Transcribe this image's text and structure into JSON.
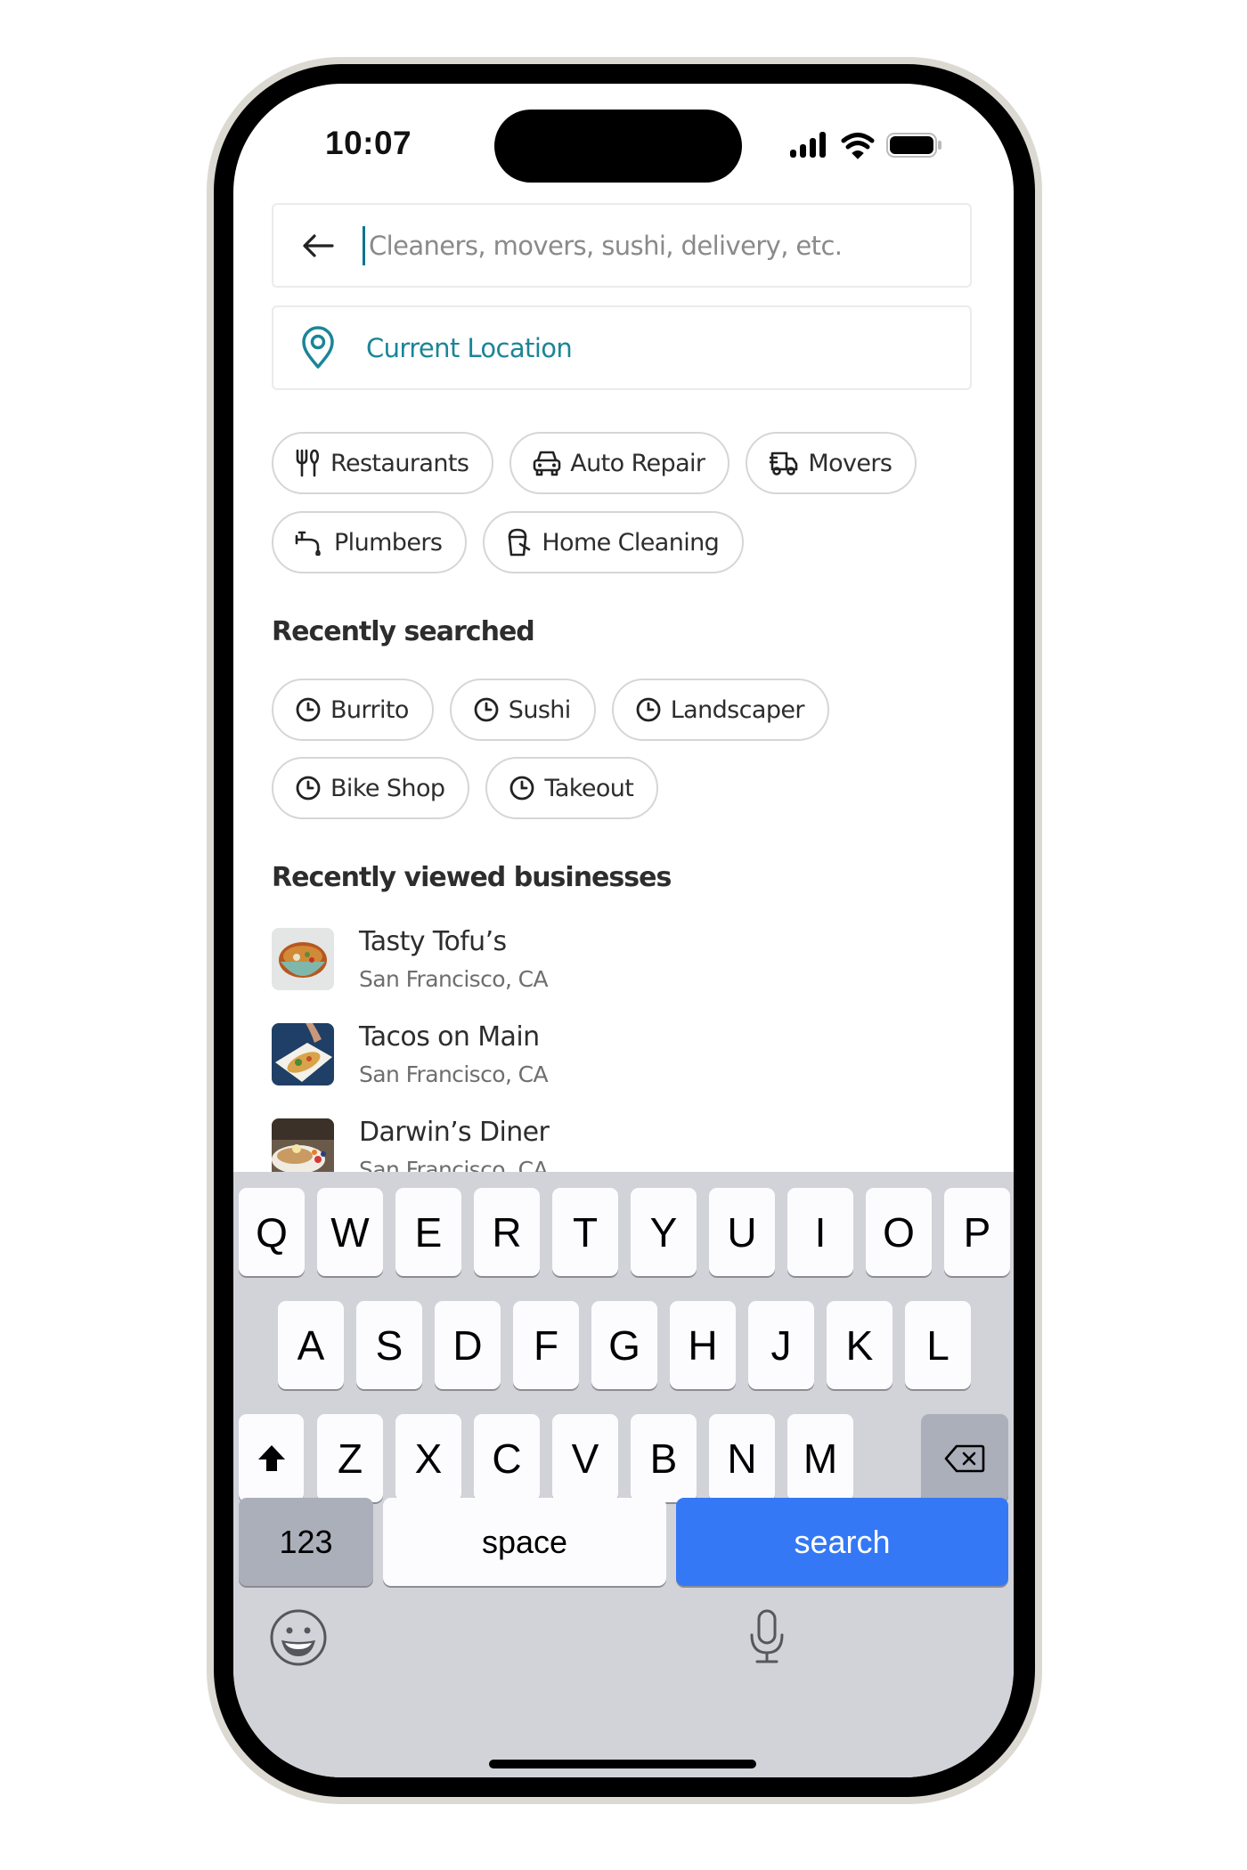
{
  "status_bar": {
    "time": "10:07",
    "icons": [
      "cellular-signal-icon",
      "wifi-icon",
      "battery-icon"
    ]
  },
  "search": {
    "back_icon": "arrow-left-icon",
    "value": "",
    "placeholder": "Cleaners, movers, sushi, delivery, etc."
  },
  "location": {
    "icon": "map-pin-icon",
    "label": "Current Location",
    "color": "#1b8597"
  },
  "categories": [
    {
      "label": "Restaurants",
      "icon": "utensils-icon"
    },
    {
      "label": "Auto Repair",
      "icon": "car-icon"
    },
    {
      "label": "Movers",
      "icon": "truck-icon"
    },
    {
      "label": "Plumbers",
      "icon": "faucet-icon"
    },
    {
      "label": "Home Cleaning",
      "icon": "bucket-icon"
    }
  ],
  "recently_searched": {
    "title": "Recently searched",
    "items": [
      {
        "label": "Burrito",
        "icon": "clock-icon"
      },
      {
        "label": "Sushi",
        "icon": "clock-icon"
      },
      {
        "label": "Landscaper",
        "icon": "clock-icon"
      },
      {
        "label": "Bike Shop",
        "icon": "clock-icon"
      },
      {
        "label": "Takeout",
        "icon": "clock-icon"
      }
    ]
  },
  "recently_viewed": {
    "title": "Recently viewed businesses",
    "items": [
      {
        "name": "Tasty Tofu’s",
        "location": "San Francisco, CA"
      },
      {
        "name": "Tacos on Main",
        "location": "San Francisco, CA"
      },
      {
        "name": "Darwin’s Diner",
        "location": "San Francisco, CA"
      }
    ]
  },
  "keyboard": {
    "row1": [
      "Q",
      "W",
      "E",
      "R",
      "T",
      "Y",
      "U",
      "I",
      "O",
      "P"
    ],
    "row2": [
      "A",
      "S",
      "D",
      "F",
      "G",
      "H",
      "J",
      "K",
      "L"
    ],
    "row3": [
      "Z",
      "X",
      "C",
      "V",
      "B",
      "N",
      "M"
    ],
    "numbers_label": "123",
    "space_label": "space",
    "action_label": "search",
    "action_color": "#3478f6",
    "shift_icon": "shift-icon",
    "delete_icon": "backspace-icon",
    "emoji_icon": "emoji-icon",
    "mic_icon": "microphone-icon"
  }
}
